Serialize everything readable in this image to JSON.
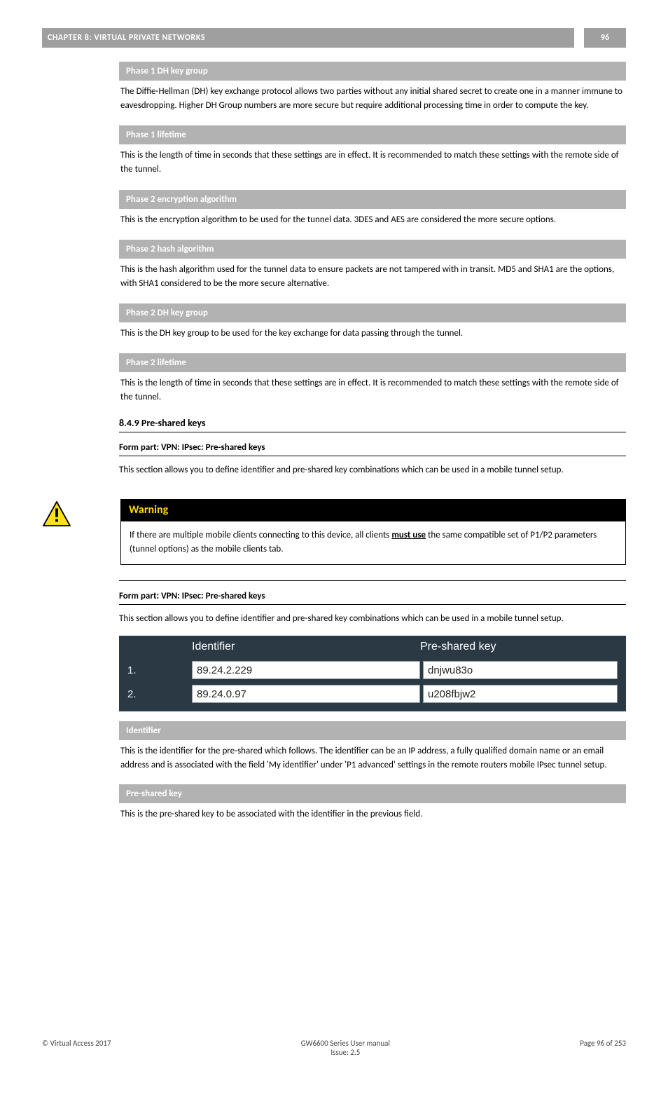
{
  "header": {
    "title": "CHAPTER 8: VIRTUAL PRIVATE NETWORKS",
    "page": "96"
  },
  "params": [
    {
      "head": "Phase 1 DH key group",
      "body": "The Diffie-Hellman (DH) key exchange protocol allows two parties without any initial shared secret to create one in a manner immune to eavesdropping. Higher DH Group numbers are more secure but require additional processing time in order to compute the key."
    },
    {
      "head": "Phase 1 lifetime",
      "body": "This is the length of time in seconds that these settings are in effect. It is recommended to match these settings with the remote side of the tunnel."
    },
    {
      "head": "Phase 2 encryption algorithm",
      "body": "This is the encryption algorithm to be used for the tunnel data. 3DES and AES are considered the more secure options."
    },
    {
      "head": "Phase 2 hash algorithm",
      "body": "This is the hash algorithm used for the tunnel data to ensure packets are not tampered with in transit. MD5 and SHA1 are the options, with SHA1 considered to be the more secure alternative."
    },
    {
      "head": "Phase 2 DH key group",
      "body": "This is the DH key group to be used for the key exchange for data passing through the tunnel."
    },
    {
      "head": "Phase 2 lifetime",
      "body": "This is the length of time in seconds that these settings are in effect. It is recommended to match these settings with the remote side of the tunnel."
    }
  ],
  "section849": {
    "title": "8.4.9 Pre-shared keys",
    "subtitle": "Form part: VPN: IPsec: Pre-shared keys",
    "intro": "This section allows you to define identifier and pre-shared key combinations which can be used in a mobile tunnel setup."
  },
  "warning": {
    "head": "Warning",
    "body_prefix": "If there are multiple mobile clients connecting to this device, all clients ",
    "body_underline": "must use",
    "body_suffix": " the same compatible set of P1/P2 parameters (tunnel options) as the mobile clients tab."
  },
  "psk_table": {
    "col_id": "Identifier",
    "col_key": "Pre-shared key",
    "rows": [
      {
        "num": "1.",
        "identifier": "89.24.2.229",
        "key": "dnjwu83o"
      },
      {
        "num": "2.",
        "identifier": "89.24.0.97",
        "key": "u208fbjw2"
      }
    ]
  },
  "captions": [
    {
      "head": "Identifier",
      "body": "This is the identifier for the pre-shared which follows. The identifier can be an IP address, a fully qualified domain name or an email address and is associated with the field 'My identifier' under 'P1 advanced' settings in the remote routers mobile IPsec tunnel setup."
    },
    {
      "head": "Pre-shared key",
      "body": "This is the pre-shared key to be associated with the identifier in the previous field."
    }
  ],
  "footer": {
    "left": "© Virtual Access 2017",
    "center": "GW6600 Series User manual\nIssue: 2.5",
    "right": "Page 96 of 253"
  }
}
